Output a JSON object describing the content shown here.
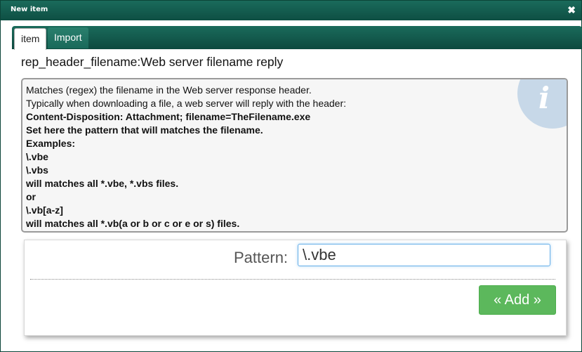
{
  "window": {
    "title": "New item",
    "close_glyph": "✖"
  },
  "tabs": [
    {
      "label": "item",
      "active": true
    },
    {
      "label": "Import",
      "active": false
    }
  ],
  "heading": "rep_header_filename:Web server filename reply",
  "help": {
    "icon": "info-icon",
    "lines": [
      {
        "text": "Matches (regex) the filename in the Web server response header.",
        "bold": false
      },
      {
        "text": "Typically when downloading a file, a web server will reply with the header:",
        "bold": false
      },
      {
        "text": "Content-Disposition: Attachment; filename=TheFilename.exe",
        "bold": true
      },
      {
        "text": "Set here the pattern that will matches the filename.",
        "bold": true
      },
      {
        "text": "Examples:",
        "bold": true
      },
      {
        "text": "\\.vbe",
        "bold": true
      },
      {
        "text": "\\.vbs",
        "bold": true
      },
      {
        "text": "will matches all *.vbe, *.vbs files.",
        "bold": true
      },
      {
        "text": "or",
        "bold": true
      },
      {
        "text": "\\.vb[a-z]",
        "bold": true
      },
      {
        "text": "will matches all *.vb(a or b or c or e or s) files.",
        "bold": true
      }
    ]
  },
  "form": {
    "pattern_label": "Pattern:",
    "pattern_value": "\\.vbe",
    "add_label": "« Add »"
  },
  "colors": {
    "titlebar": "#0e4f43",
    "add_button": "#5cb85c",
    "input_focus": "#66afe9"
  }
}
